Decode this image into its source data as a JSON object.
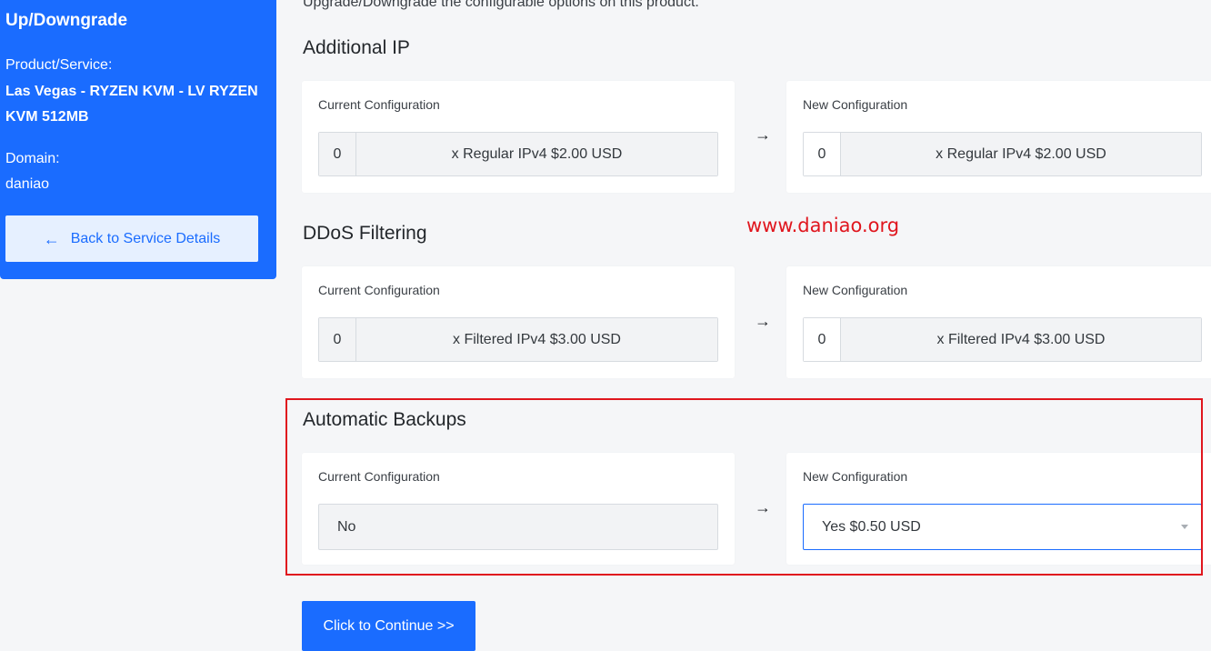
{
  "sidebar": {
    "title": "Up/Downgrade",
    "product_label": "Product/Service:",
    "product_name": "Las Vegas - RYZEN KVM - LV RYZEN KVM 512MB",
    "domain_label": "Domain:",
    "domain_value": "daniao",
    "back_button_label": "Back to Service Details",
    "back_icon": "arrow-left-icon"
  },
  "intro_text": "Upgrade/Downgrade the configurable options on this product.",
  "current_label": "Current Configuration",
  "new_label": "New Configuration",
  "arrow_glyph": "→",
  "sections": [
    {
      "title": "Additional IP",
      "current": {
        "qty": "0",
        "addon": "x Regular IPv4 $2.00 USD"
      },
      "new": {
        "qty": "0",
        "addon": "x Regular IPv4 $2.00 USD"
      }
    },
    {
      "title": "DDoS Filtering",
      "current": {
        "qty": "0",
        "addon": "x Filtered IPv4 $3.00 USD"
      },
      "new": {
        "qty": "0",
        "addon": "x Filtered IPv4 $3.00 USD"
      }
    },
    {
      "title": "Automatic Backups",
      "current": {
        "value": "No"
      },
      "new": {
        "selected": "Yes $0.50 USD"
      }
    }
  ],
  "watermark": "www.daniao.org",
  "continue_button_label": "Click to Continue >>",
  "colors": {
    "brand": "#1a6cff",
    "highlight": "#e0161e",
    "background": "#f5f6f8"
  }
}
